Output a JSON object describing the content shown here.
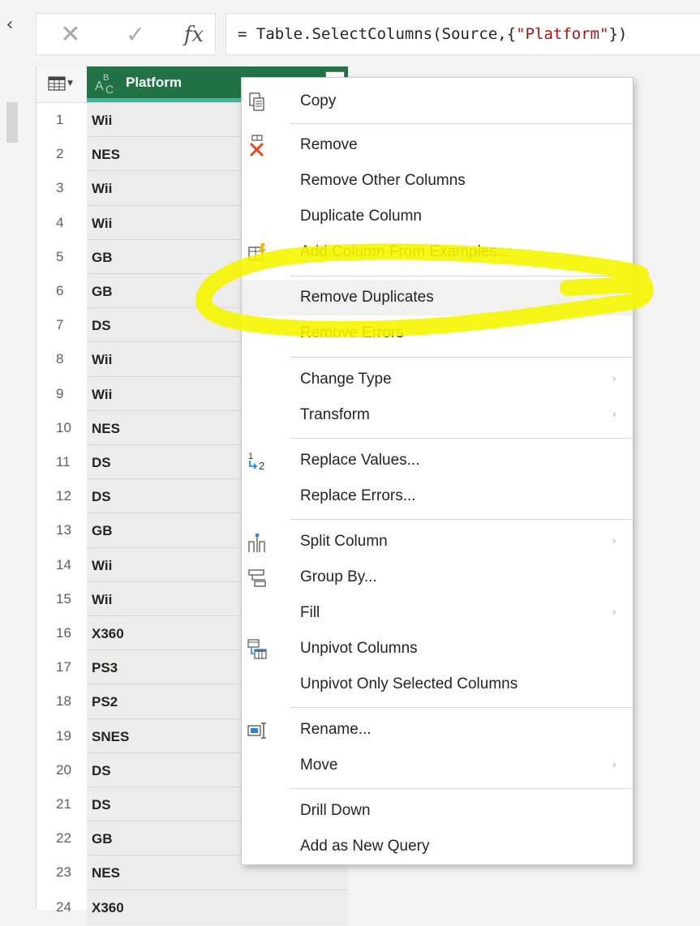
{
  "formula_bar": {
    "cancel_icon": "close-icon",
    "commit_icon": "check-icon",
    "fx_label": "fx",
    "formula_prefix": "= Table.SelectColumns(Source,{",
    "formula_string": "\"Platform\"",
    "formula_suffix": "})"
  },
  "grid": {
    "column": {
      "title": "Platform",
      "type_icon": "text-type-icon",
      "header_color": "#217346",
      "accent_color": "#3bb5a0"
    },
    "rows": [
      {
        "n": "1",
        "v": "Wii"
      },
      {
        "n": "2",
        "v": "NES"
      },
      {
        "n": "3",
        "v": "Wii"
      },
      {
        "n": "4",
        "v": "Wii"
      },
      {
        "n": "5",
        "v": "GB"
      },
      {
        "n": "6",
        "v": "GB"
      },
      {
        "n": "7",
        "v": "DS"
      },
      {
        "n": "8",
        "v": "Wii"
      },
      {
        "n": "9",
        "v": "Wii"
      },
      {
        "n": "10",
        "v": "NES"
      },
      {
        "n": "11",
        "v": "DS"
      },
      {
        "n": "12",
        "v": "DS"
      },
      {
        "n": "13",
        "v": "GB"
      },
      {
        "n": "14",
        "v": "Wii"
      },
      {
        "n": "15",
        "v": "Wii"
      },
      {
        "n": "16",
        "v": "X360"
      },
      {
        "n": "17",
        "v": "PS3"
      },
      {
        "n": "18",
        "v": "PS2"
      },
      {
        "n": "19",
        "v": "SNES"
      },
      {
        "n": "20",
        "v": "DS"
      },
      {
        "n": "21",
        "v": "DS"
      },
      {
        "n": "22",
        "v": "GB"
      },
      {
        "n": "23",
        "v": "NES"
      },
      {
        "n": "24",
        "v": "X360"
      }
    ]
  },
  "context_menu": {
    "items": [
      {
        "label": "Copy",
        "icon": "copy-icon"
      },
      {
        "label": "Remove",
        "icon": "remove-column-icon"
      },
      {
        "label": "Remove Other Columns"
      },
      {
        "label": "Duplicate Column"
      },
      {
        "label": "Add Column From Examples...",
        "icon": "add-column-examples-icon"
      },
      {
        "label": "Remove Duplicates",
        "hover": true
      },
      {
        "label": "Remove Errors"
      },
      {
        "label": "Change Type",
        "submenu": true
      },
      {
        "label": "Transform",
        "submenu": true
      },
      {
        "label": "Replace Values...",
        "icon": "replace-values-icon"
      },
      {
        "label": "Replace Errors..."
      },
      {
        "label": "Split Column",
        "icon": "split-column-icon",
        "submenu": true
      },
      {
        "label": "Group By...",
        "icon": "group-by-icon"
      },
      {
        "label": "Fill",
        "submenu": true
      },
      {
        "label": "Unpivot Columns",
        "icon": "unpivot-icon"
      },
      {
        "label": "Unpivot Only Selected Columns"
      },
      {
        "label": "Rename...",
        "icon": "rename-icon"
      },
      {
        "label": "Move",
        "submenu": true
      },
      {
        "label": "Drill Down"
      },
      {
        "label": "Add as New Query"
      }
    ],
    "submenu_glyph": "›"
  },
  "annotation": {
    "color": "#f5f500"
  }
}
